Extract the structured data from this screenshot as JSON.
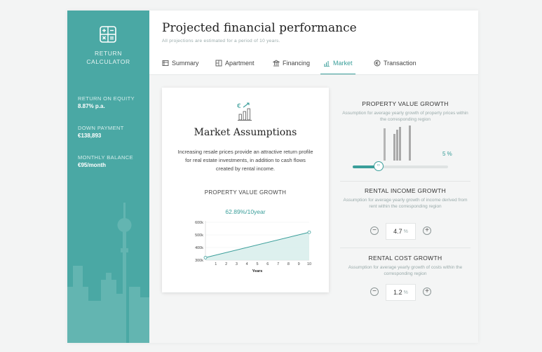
{
  "sidebar": {
    "title_line1": "RETURN",
    "title_line2": "CALCULATOR",
    "metrics": [
      {
        "label": "RETURN ON EQUITY",
        "value": "8.87% p.a."
      },
      {
        "label": "DOWN PAYMENT",
        "value": "€138,893"
      },
      {
        "label": "MONTHLY BALANCE",
        "value": "€95/month"
      }
    ]
  },
  "header": {
    "title": "Projected financial performance",
    "subtitle": "All projections are estimated for a period of 10 years."
  },
  "tabs": [
    {
      "label": "Summary",
      "icon": "summary-icon"
    },
    {
      "label": "Apartment",
      "icon": "apartment-icon"
    },
    {
      "label": "Financing",
      "icon": "bank-icon"
    },
    {
      "label": "Market",
      "icon": "market-chart-icon",
      "active": true
    },
    {
      "label": "Transaction",
      "icon": "transaction-icon"
    }
  ],
  "card": {
    "title": "Market Assumptions",
    "text": "Increasing resale prices provide an attractive return profile for real estate investments, in addition to cash flows created by rental income.",
    "chart_title": "PROPERTY VALUE GROWTH",
    "chart_subtitle": "62.89%/10year"
  },
  "chart_data": {
    "type": "area",
    "title": "PROPERTY VALUE GROWTH",
    "subtitle": "62.89%/10year",
    "xlabel": "Years",
    "ylabel": "",
    "x": [
      0,
      10
    ],
    "values": [
      320,
      521
    ],
    "xticks": [
      "1",
      "2",
      "3",
      "4",
      "5",
      "6",
      "7",
      "8",
      "9",
      "10"
    ],
    "yticks": [
      "300k",
      "400k",
      "500k",
      "600k"
    ],
    "ylim": [
      300,
      600
    ],
    "xlim": [
      0,
      10
    ]
  },
  "assumptions": {
    "property": {
      "title": "PROPERTY VALUE GROWTH",
      "desc": "Assumption for average yearly growth of property prices within the corresponding region",
      "value": "5 %",
      "slider_fraction": 0.27
    },
    "rental_income": {
      "title": "RENTAL INCOME GROWTH",
      "desc": "Assumption for average yearly growth of income derived from rent within the corresponding region",
      "value": "4.7",
      "unit": "%",
      "minus": "−",
      "plus": "+"
    },
    "rental_cost": {
      "title": "RENTAL COST GROWTH",
      "desc": "Assumption for average yearly growth of costs within the corresponding region",
      "value": "1.2",
      "unit": "%",
      "minus": "−",
      "plus": "+"
    }
  },
  "colors": {
    "accent": "#3a9e9a",
    "sidebar": "#4aa8a4"
  }
}
